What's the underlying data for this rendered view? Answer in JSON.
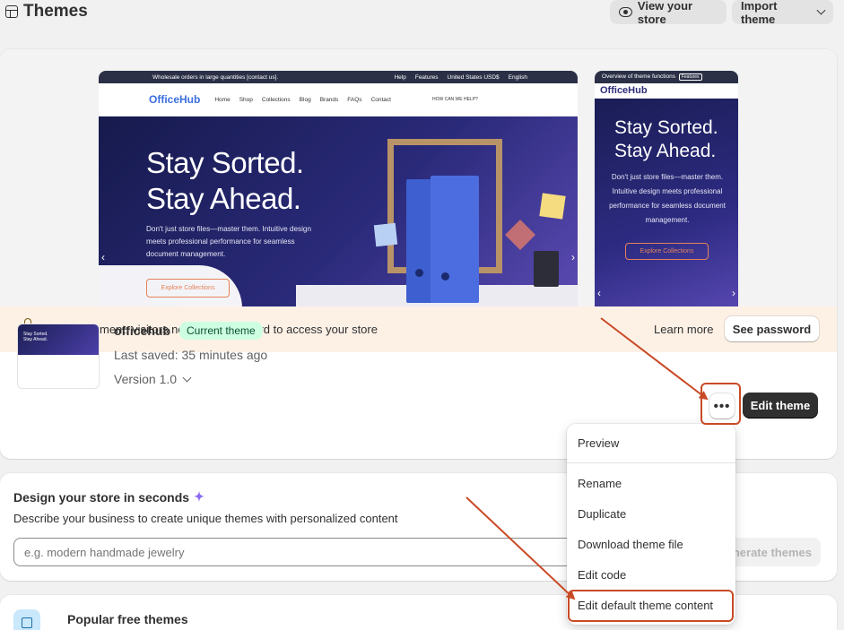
{
  "header": {
    "title": "Themes",
    "view_store_label": "View your store",
    "import_theme_label": "Import theme"
  },
  "preview": {
    "desktop": {
      "announcement": "Wholesale orders in large quantities [contact us].",
      "top_links": [
        "Help",
        "Features",
        "United States USD$",
        "English"
      ],
      "logo": "OfficeHub",
      "nav": [
        "Home",
        "Shop",
        "Collections",
        "Blog",
        "Brands",
        "FAQs",
        "Contact"
      ],
      "contact": "HOW CAN WE HELP?",
      "headline_line1": "Stay Sorted.",
      "headline_line2": "Stay Ahead.",
      "subtext": "Don't just store files—master them. Intuitive design meets professional performance for seamless document management.",
      "cta": "Explore Collections"
    },
    "mobile": {
      "top_text": "Overview of theme functions",
      "top_badge": "Features",
      "logo": "OfficeHub",
      "headline_line1": "Stay Sorted.",
      "headline_line2": "Stay Ahead.",
      "subtext": "Don't just store files—master them. Intuitive design meets professional performance for seamless document management.",
      "cta": "Explore Collections"
    }
  },
  "dev_banner": {
    "text": "In development: visitors need the password to access your store",
    "learn_more": "Learn more",
    "see_password": "See password"
  },
  "current_theme": {
    "name": "officehub",
    "badge": "Current theme",
    "last_saved": "Last saved: 35 minutes ago",
    "version": "Version 1.0",
    "more_label": "•••",
    "edit_label": "Edit theme",
    "thumb_line1": "Stay Sorted.",
    "thumb_line2": "Stay Ahead."
  },
  "menu": {
    "items": [
      "Preview",
      "Rename",
      "Duplicate",
      "Download theme file",
      "Edit code",
      "Edit default theme content"
    ]
  },
  "design": {
    "title": "Design your store in seconds",
    "description": "Describe your business to create unique themes with personalized content",
    "input_placeholder": "e.g. modern handmade jewelry",
    "generate_label": "Generate themes"
  },
  "popular": {
    "title": "Popular free themes"
  },
  "colors": {
    "highlight": "#c94a26",
    "badge_bg": "#cdfee1",
    "dev_banner_bg": "#fdf1e6",
    "primary_button": "#303030"
  }
}
